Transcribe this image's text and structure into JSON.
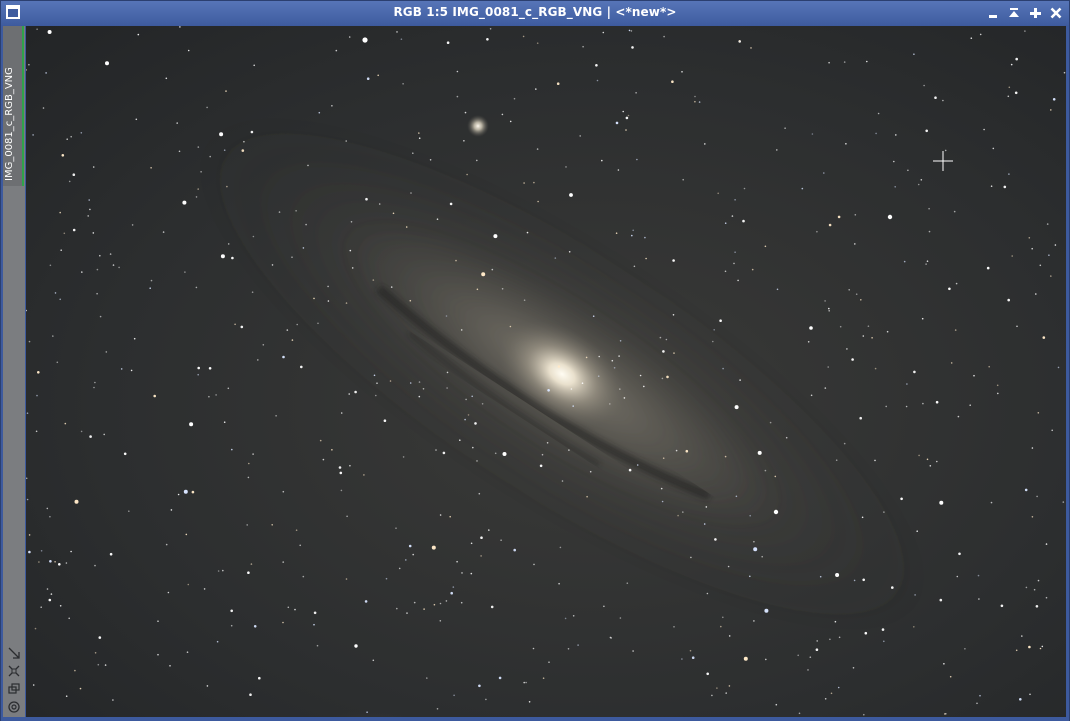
{
  "window": {
    "title": "RGB 1:5 IMG_0081_c_RGB_VNG | <*new*>",
    "colors": {
      "titlebar": "#4a67ab",
      "title_text": "#ffffff",
      "sidebar": "#7b7d80",
      "active_tab_accent": "#2fa34a",
      "sky_background": "#26282a"
    },
    "controls": {
      "menu_icon": "window-menu-icon",
      "minimize_icon": "minimize-icon",
      "shade_icon": "shade-icon",
      "maximize_icon": "maximize-icon",
      "close_icon": "close-icon"
    }
  },
  "sidebar": {
    "tab_label": "IMG_0081_c_RGB_VNG",
    "tools": [
      {
        "icon": "resize-arrow-icon"
      },
      {
        "icon": "zoom-fit-icon"
      },
      {
        "icon": "clone-view-icon"
      },
      {
        "icon": "target-icon"
      }
    ]
  },
  "image": {
    "subject": "Andromeda galaxy star field",
    "cursor_icon": "crosshair-cursor-icon"
  }
}
